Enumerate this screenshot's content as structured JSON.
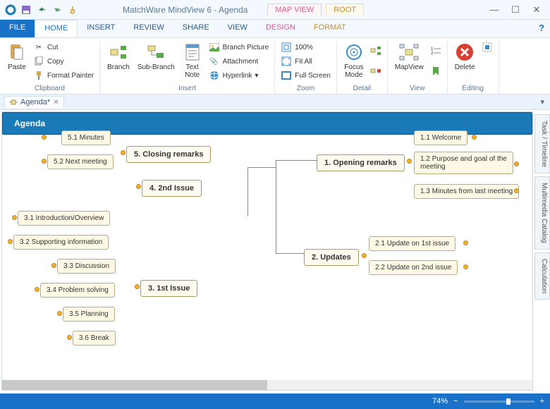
{
  "app": {
    "title": "MatchWare MindView 6 - Agenda"
  },
  "context_tabs": {
    "mapview": "MAP VIEW",
    "root": "ROOT"
  },
  "tabs": {
    "file": "FILE",
    "home": "HOME",
    "insert": "INSERT",
    "review": "REVIEW",
    "share": "SHARE",
    "view": "VIEW",
    "design": "DESIGN",
    "format": "FORMAT"
  },
  "ribbon": {
    "clipboard": {
      "label": "Clipboard",
      "paste": "Paste",
      "cut": "Cut",
      "copy": "Copy",
      "format_painter": "Format Painter"
    },
    "insert": {
      "label": "Insert",
      "branch": "Branch",
      "subbranch": "Sub-Branch",
      "textnote": "Text\nNote",
      "branch_picture": "Branch Picture",
      "attachment": "Attachment",
      "hyperlink": "Hyperlink"
    },
    "zoom": {
      "label": "Zoom",
      "p100": "100%",
      "fitall": "Fit All",
      "fullscreen": "Full Screen"
    },
    "detail": {
      "label": "Detail",
      "focus": "Focus\nMode"
    },
    "view": {
      "label": "View",
      "mapview": "MapView"
    },
    "editing": {
      "label": "Editing",
      "delete": "Delete"
    }
  },
  "doc_tab": {
    "name": "Agenda*"
  },
  "side": {
    "task": "Task / Timeline",
    "multimedia": "Multimedia Catalog",
    "calc": "Calculation"
  },
  "mindmap": {
    "root": "Agenda",
    "b1": {
      "title": "1.  Opening remarks",
      "c1": "1.1  Welcome",
      "c2": "1.2  Purpose and goal of the\n        meeting",
      "c3": "1.3  Minutes from last meeting"
    },
    "b2": {
      "title": "2.  Updates",
      "c1": "2.1  Update on 1st issue",
      "c2": "2.2  Update on 2nd issue"
    },
    "b3": {
      "title": "3.  1st Issue",
      "c1": "3.1  Introduction/Overview",
      "c2": "3.2  Supporting information",
      "c3": "3.3  Discussion",
      "c4": "3.4  Problem solving",
      "c5": "3.5  Planning",
      "c6": "3.6  Break"
    },
    "b4": {
      "title": "4.  2nd Issue"
    },
    "b5": {
      "title": "5.  Closing remarks",
      "c1": "5.1  Minutes",
      "c2": "5.2  Next meeting"
    }
  },
  "status": {
    "zoom": "74%"
  }
}
